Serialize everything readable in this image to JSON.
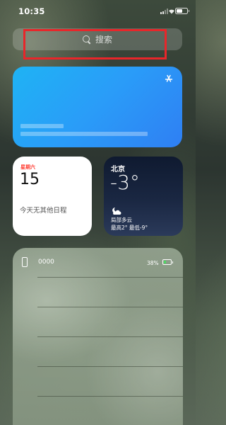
{
  "status_bar": {
    "time": "10:35",
    "charging": true
  },
  "search": {
    "placeholder": "搜索",
    "highlight_color": "#e8262a"
  },
  "appstore_widget": {
    "icon": "app-store-icon",
    "background_colors": [
      "#1fb3f4",
      "#2f7ff3"
    ]
  },
  "calendar_widget": {
    "weekday": "星期六",
    "day": "15",
    "no_events_text": "今天无其他日程",
    "weekday_color": "#ff3b30"
  },
  "weather_widget": {
    "city": "北京",
    "temperature": "-3°",
    "condition_icon": "partly-cloudy-night-icon",
    "condition": "局部多云",
    "range": "最高2° 最低-9°"
  },
  "battery_widget": {
    "device_icon": "iphone-icon",
    "device_name": "0000",
    "percent_text": "38%",
    "level": 0.38,
    "charging": true,
    "empty_slots": 4
  }
}
